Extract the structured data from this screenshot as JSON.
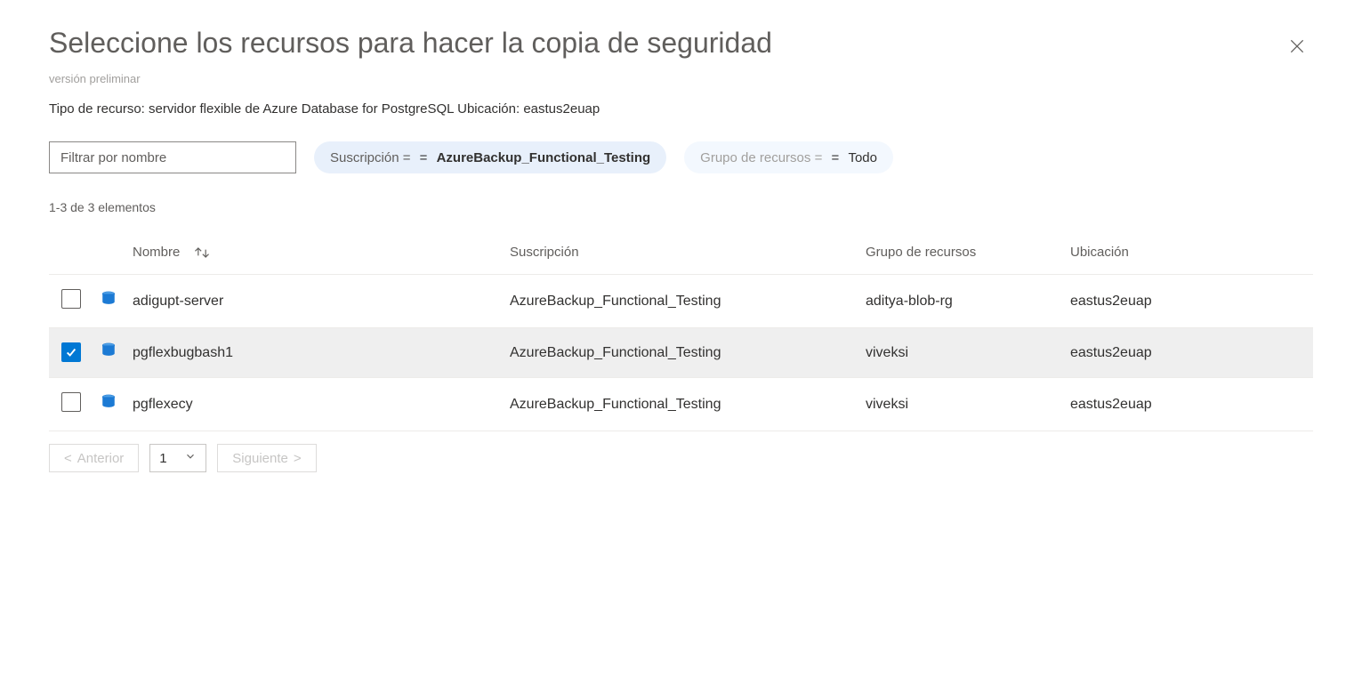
{
  "header": {
    "title": "Seleccione los recursos para hacer la copia de seguridad",
    "subtitle": "versión preliminar",
    "info_line": "Tipo de recurso: servidor flexible de Azure Database for PostgreSQL Ubicación: eastus2euap"
  },
  "filters": {
    "name_placeholder": "Filtrar por nombre",
    "subscription_label": "Suscripción =",
    "subscription_value": "AzureBackup_Functional_Testing",
    "resourcegroup_label": "Grupo de recursos =",
    "resourcegroup_value": "Todo"
  },
  "grid": {
    "count": "1-3 de 3 elementos",
    "headers": {
      "name": "Nombre",
      "subscription": "Suscripción",
      "resourcegroup": "Grupo de recursos",
      "location": "Ubicación"
    },
    "rows": [
      {
        "selected": false,
        "name": "adigupt-server",
        "subscription": "AzureBackup_Functional_Testing",
        "resourcegroup": "aditya-blob-rg",
        "location": "eastus2euap"
      },
      {
        "selected": true,
        "name": "pgflexbugbash1",
        "subscription": "AzureBackup_Functional_Testing",
        "resourcegroup": "viveksi",
        "location": "eastus2euap"
      },
      {
        "selected": false,
        "name": "pgflexecy",
        "subscription": "AzureBackup_Functional_Testing",
        "resourcegroup": "viveksi",
        "location": "eastus2euap"
      }
    ]
  },
  "pager": {
    "previous": "Anterior",
    "page": "1",
    "next": "Siguiente"
  }
}
